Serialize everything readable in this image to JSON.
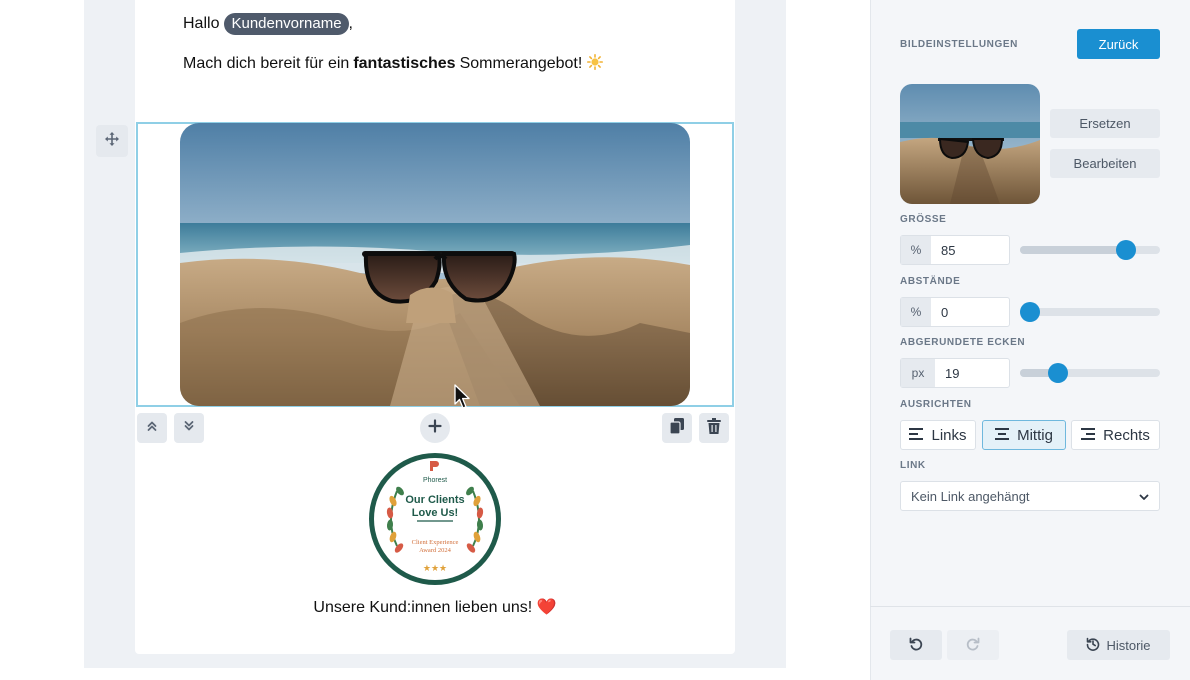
{
  "email": {
    "greeting_prefix": "Hallo",
    "placeholder_token": "Kundenvorname",
    "greeting_suffix": ",",
    "intro_before": "Mach dich bereit für ein",
    "intro_bold": "fantastisches",
    "intro_after": "Sommerangebot!",
    "intro_emoji": "☀",
    "badge": {
      "brand": "Phorest",
      "line1": "Our Clients",
      "line2": "Love Us!",
      "award_line1": "Client Experience",
      "award_line2": "Award 2024",
      "stars": "★★★"
    },
    "caption": "Unsere Kund:innen lieben uns!",
    "caption_emoji": "❤️"
  },
  "panel": {
    "title": "BILDEINSTELLUNGEN",
    "back_label": "Zurück",
    "replace_label": "Ersetzen",
    "edit_label": "Bearbeiten",
    "size": {
      "label": "GRÖSSE",
      "unit": "%",
      "value": "85",
      "slider_fraction": 0.8
    },
    "spacing": {
      "label": "ABSTÄNDE",
      "unit": "%",
      "value": "0",
      "slider_fraction": 0.0
    },
    "radius": {
      "label": "ABGERUNDETE ECKEN",
      "unit": "px",
      "value": "19",
      "slider_fraction": 0.23
    },
    "align": {
      "label": "AUSRICHTEN",
      "options": [
        "Links",
        "Mittig",
        "Rechts"
      ],
      "selected": "Mittig"
    },
    "link": {
      "label": "LINK",
      "value": "Kein Link angehängt"
    },
    "footer": {
      "history_label": "Historie"
    }
  },
  "colors": {
    "accent": "#1a8fd1",
    "selection_border": "#8fcfe6",
    "badge_green": "#1f5a4a"
  },
  "icons": [
    "move-icon",
    "move-up-icon",
    "move-down-icon",
    "add-icon",
    "copy-icon",
    "trash-icon",
    "undo-icon",
    "redo-icon",
    "history-icon",
    "chevron-down-icon",
    "align-left-icon",
    "align-center-icon",
    "align-right-icon"
  ]
}
